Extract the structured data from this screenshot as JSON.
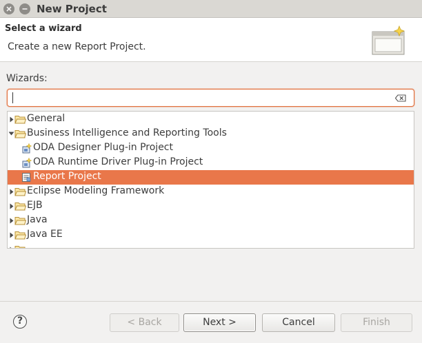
{
  "window": {
    "title": "New Project"
  },
  "header": {
    "title": "Select a wizard",
    "description": "Create a new Report Project."
  },
  "wizards": {
    "label": "Wizards:",
    "filter_value": "",
    "items": [
      {
        "label": "General",
        "type": "folder",
        "expanded": false,
        "level": 0
      },
      {
        "label": "Business Intelligence and Reporting Tools",
        "type": "folder",
        "expanded": true,
        "level": 0
      },
      {
        "label": "ODA Designer Plug-in Project",
        "type": "plugin-wizard",
        "level": 1
      },
      {
        "label": "ODA Runtime Driver Plug-in Project",
        "type": "plugin-wizard",
        "level": 1
      },
      {
        "label": "Report Project",
        "type": "report-wizard",
        "level": 1,
        "selected": true
      },
      {
        "label": "Eclipse Modeling Framework",
        "type": "folder",
        "expanded": false,
        "level": 0
      },
      {
        "label": "EJB",
        "type": "folder",
        "expanded": false,
        "level": 0
      },
      {
        "label": "Java",
        "type": "folder",
        "expanded": false,
        "level": 0
      },
      {
        "label": "Java EE",
        "type": "folder",
        "expanded": false,
        "level": 0
      }
    ]
  },
  "buttons": {
    "help": "?",
    "back": "< Back",
    "next": "Next >",
    "cancel": "Cancel",
    "finish": "Finish"
  },
  "colors": {
    "selection": "#e9774a",
    "focus_border": "#e07240",
    "titlebar": "#dad8d3"
  },
  "icons": {
    "close": "close-icon",
    "minimize": "minimize-icon",
    "banner": "new-wizard-banner-icon",
    "clear": "clear-filter-icon",
    "folder": "folder-icon",
    "plugin": "plugin-project-icon",
    "report": "report-project-icon"
  }
}
